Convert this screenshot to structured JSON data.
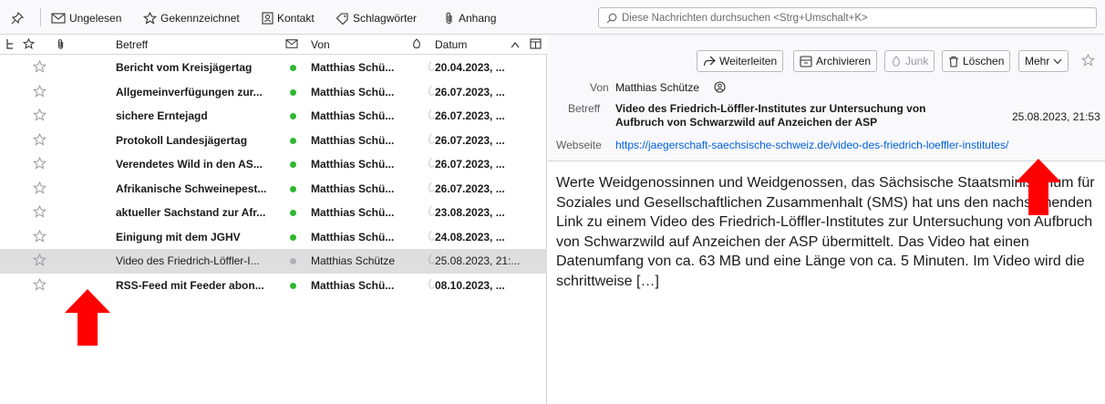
{
  "toolbar": {
    "unread_label": "Ungelesen",
    "starred_label": "Gekennzeichnet",
    "contact_label": "Kontakt",
    "tags_label": "Schlagwörter",
    "attachment_label": "Anhang",
    "search_placeholder": "Diese Nachrichten durchsuchen <Strg+Umschalt+K>"
  },
  "list": {
    "columns": {
      "subject": "Betreff",
      "from": "Von",
      "date": "Datum"
    },
    "rows": [
      {
        "subject": "Bericht vom Kreisjägertag",
        "from": "Matthias Schü...",
        "date": "20.04.2023, ..."
      },
      {
        "subject": "Allgemeinverfügungen zur...",
        "from": "Matthias Schü...",
        "date": "26.07.2023, ..."
      },
      {
        "subject": "sichere Erntejagd",
        "from": "Matthias Schü...",
        "date": "26.07.2023, ..."
      },
      {
        "subject": "Protokoll Landesjägertag",
        "from": "Matthias Schü...",
        "date": "26.07.2023, ..."
      },
      {
        "subject": "Verendetes Wild in den AS...",
        "from": "Matthias Schü...",
        "date": "26.07.2023, ..."
      },
      {
        "subject": "Afrikanische Schweinepest...",
        "from": "Matthias Schü...",
        "date": "26.07.2023, ..."
      },
      {
        "subject": "aktueller Sachstand zur Afr...",
        "from": "Matthias Schü...",
        "date": "23.08.2023, ..."
      },
      {
        "subject": "Einigung mit dem JGHV",
        "from": "Matthias Schü...",
        "date": "24.08.2023, ..."
      },
      {
        "subject": "Video des Friedrich-Löffler-I...",
        "from": "Matthias Schütze",
        "date": "25.08.2023, 21:..."
      },
      {
        "subject": "RSS-Feed mit Feeder abon...",
        "from": "Matthias Schü...",
        "date": "08.10.2023, ..."
      }
    ]
  },
  "preview": {
    "buttons": {
      "forward": "Weiterleiten",
      "archive": "Archivieren",
      "junk": "Junk",
      "delete": "Löschen",
      "more": "Mehr"
    },
    "from_label": "Von",
    "from_value": "Matthias Schütze",
    "subject_label": "Betreff",
    "subject_value": "Video des Friedrich-Löffler-Institutes zur Untersuchung von Aufbruch von Schwarzwild auf Anzeichen der ASP",
    "date_value": "25.08.2023, 21:53",
    "website_label": "Webseite",
    "website_value": "https://jaegerschaft-saechsische-schweiz.de/video-des-friedrich-loeffler-institutes/",
    "body": "Werte Weidgenossinnen und Weidgenossen, das Sächsische Staatsministerium für Soziales und Gesellschaftlichen Zusammenhalt (SMS) hat uns den nachstehenden Link zu einem Video des Friedrich-Löffler-Institutes zur Untersuchung von Aufbruch von Schwarzwild auf Anzeichen der ASP übermittelt. Das Video hat einen Datenumfang von ca. 63 MB und eine Länge von ca. 5 Minuten. Im Video wird die schrittweise […]"
  },
  "colors": {
    "annotation_arrow": "#ff0000",
    "unread_dot": "#2eb82e",
    "link": "#0060df",
    "selected_row": "#dedede"
  }
}
